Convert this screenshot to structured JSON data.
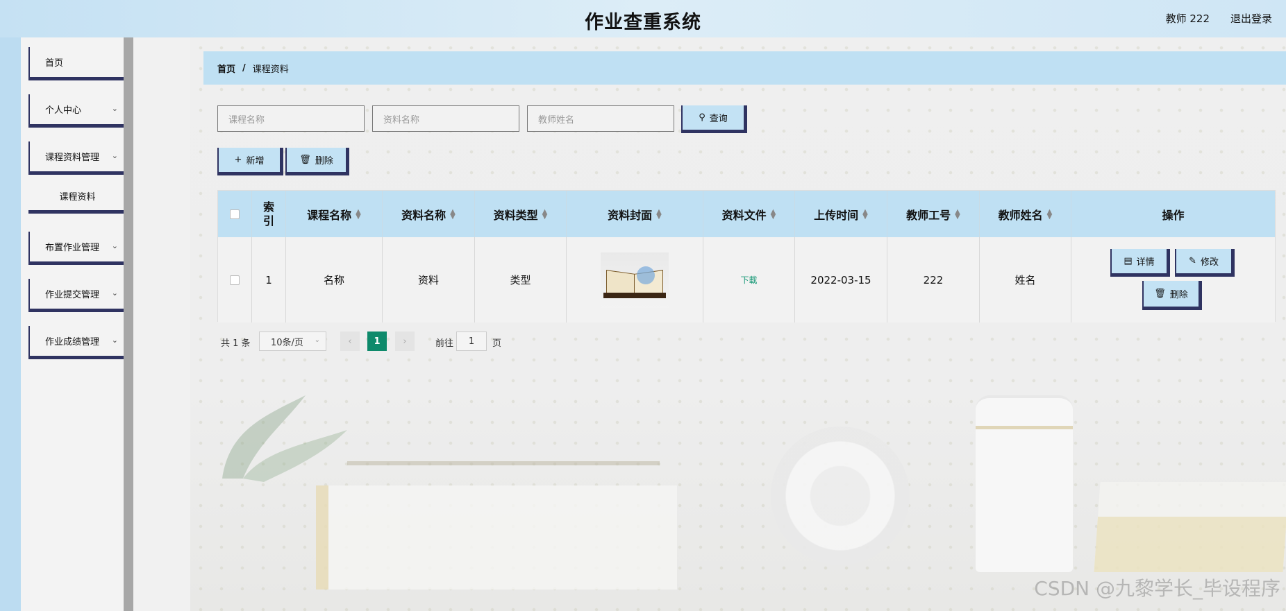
{
  "header": {
    "title": "作业查重系统",
    "user": "教师 222",
    "logout": "退出登录"
  },
  "sidebar": {
    "items": [
      {
        "label": "首页"
      },
      {
        "label": "个人中心"
      },
      {
        "label": "课程资料管理"
      },
      {
        "label": "课程资料"
      },
      {
        "label": "布置作业管理"
      },
      {
        "label": "作业提交管理"
      },
      {
        "label": "作业成绩管理"
      }
    ]
  },
  "breadcrumb": {
    "home": "首页",
    "separator": "/",
    "current": "课程资料"
  },
  "search": {
    "course_placeholder": "课程名称",
    "material_placeholder": "资料名称",
    "teacher_placeholder": "教师姓名",
    "query_label": "查询"
  },
  "toolbar": {
    "add_label": "新增",
    "delete_label": "删除"
  },
  "table": {
    "headers": [
      "索引",
      "课程名称",
      "资料名称",
      "资料类型",
      "资料封面",
      "资料文件",
      "上传时间",
      "教师工号",
      "教师姓名",
      "操作"
    ],
    "index_header_line1": "索",
    "index_header_line2": "引",
    "rows": [
      {
        "index": "1",
        "course": "名称",
        "material": "资料",
        "type": "类型",
        "file": "下載",
        "uploaded": "2022-03-15",
        "teacher_id": "222",
        "teacher_name": "姓名"
      }
    ],
    "actions": {
      "detail": "详情",
      "edit": "修改",
      "delete": "删除"
    }
  },
  "pager": {
    "total": "共 1 条",
    "page_size": "10条/页",
    "current": "1",
    "goto_label": "前往",
    "goto_value": "1",
    "page_suffix": "页"
  },
  "watermark": "CSDN @九黎学长_毕设程序",
  "colors": {
    "accent_blue": "#bfe0f3",
    "border_navy": "#2f3361",
    "pager_green": "#0e8a6b",
    "download_green": "#1a9a78"
  }
}
